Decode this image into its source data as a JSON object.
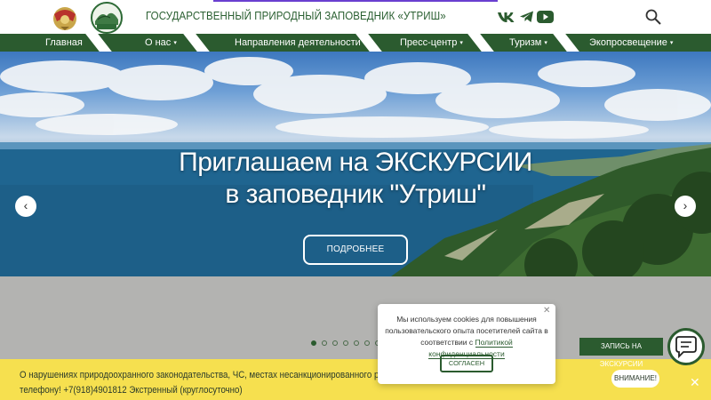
{
  "header": {
    "title": "ГОСУДАРСТВЕННЫЙ ПРИРОДНЫЙ ЗАПОВЕДНИК «УТРИШ»",
    "logo_text": "УТРИШ",
    "social_icons": [
      "vk-icon",
      "telegram-icon",
      "youtube-icon"
    ]
  },
  "nav": {
    "items": [
      {
        "label": "Главная",
        "dropdown": false
      },
      {
        "label": "О нас",
        "dropdown": true
      },
      {
        "label": "Направления деятельности",
        "dropdown": true
      },
      {
        "label": "Пресс-центр",
        "dropdown": true
      },
      {
        "label": "Туризм",
        "dropdown": true
      },
      {
        "label": "Экопросвещение",
        "dropdown": true
      }
    ],
    "caret": "▾"
  },
  "hero": {
    "title_line1": "Приглашаем на ЭКСКУРСИИ",
    "title_line2": "в заповедник \"Утриш\"",
    "button_label": "ПОДРОБНЕЕ",
    "prev_arrow": "‹",
    "next_arrow": "›"
  },
  "slider": {
    "dots_count": 7,
    "active_index": 0
  },
  "banner": {
    "line1": "О нарушениях природоохранного законодательства, ЧС, местах несанкционированного размещения отходов",
    "line2": "телефону! +7(918)4901812 Экстренный (круглосуточно)",
    "attention_label": "ВНИМАНИЕ!",
    "close_glyph": "✕"
  },
  "cookie": {
    "text": "Мы используем cookies для повышения пользовательского опыта посетителей сайта в соответствии с",
    "link_text": "Политикой конфиденциальности",
    "accept_label": "СОГЛАСЕН",
    "close_glyph": "✕"
  },
  "excursion_chip": {
    "label": "ЗАПИСЬ НА ЭКСКУРСИИ"
  },
  "colors": {
    "brand_green": "#2b5b2f",
    "banner_yellow": "#f6e04f",
    "accent_purple": "#6a3fd0"
  }
}
